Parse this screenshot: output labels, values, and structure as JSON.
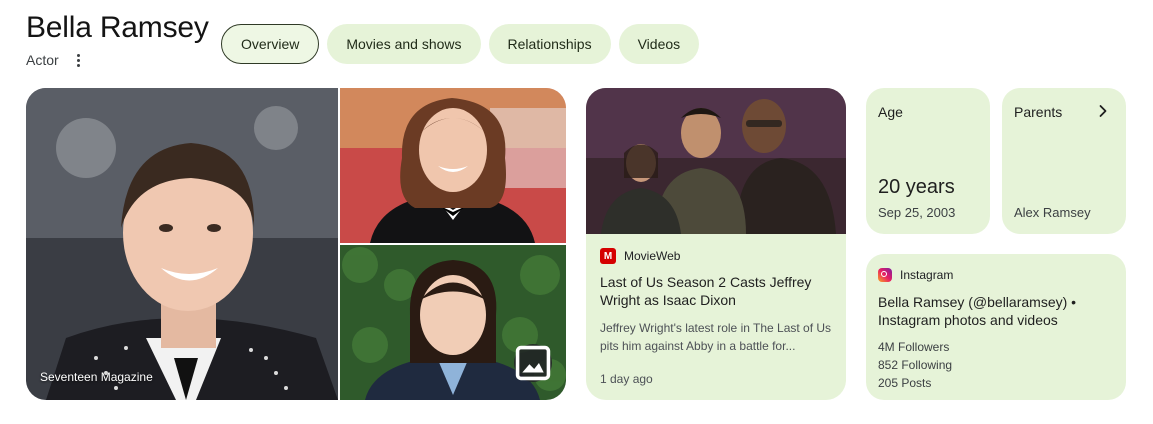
{
  "header": {
    "name": "Bella Ramsey",
    "subtitle": "Actor"
  },
  "tabs": [
    {
      "label": "Overview",
      "active": true
    },
    {
      "label": "Movies and shows",
      "active": false
    },
    {
      "label": "Relationships",
      "active": false
    },
    {
      "label": "Videos",
      "active": false
    }
  ],
  "gallery": {
    "caption": "Seventeen Magazine",
    "icon": "image-icon"
  },
  "news": {
    "source": "MovieWeb",
    "source_logo_letter": "M",
    "title": "Last of Us Season 2 Casts Jeffrey Wright as Isaac Dixon",
    "snippet": "Jeffrey Wright's latest role in The Last of Us pits him against Abby in a battle for...",
    "time": "1 day ago"
  },
  "age": {
    "label": "Age",
    "value": "20 years",
    "date": "Sep 25, 2003"
  },
  "parents": {
    "label": "Parents",
    "name": "Alex Ramsey"
  },
  "instagram": {
    "source": "Instagram",
    "title": "Bella Ramsey (@bellaramsey) • Instagram photos and videos",
    "followers": "4M Followers",
    "following": "852 Following",
    "posts": "205 Posts"
  },
  "colors": {
    "card_bg": "#e6f3d8",
    "active_tab_border": "#2f3a26",
    "movieweb_red": "#d50000"
  }
}
